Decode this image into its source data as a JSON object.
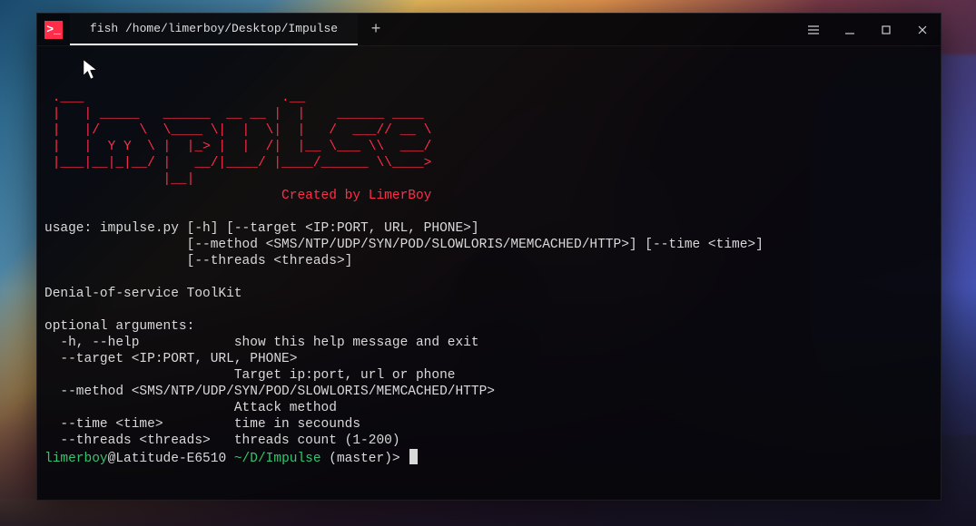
{
  "titlebar": {
    "app_badge_glyph": ">_",
    "tab_title": "fish /home/limerboy/Desktop/Impulse",
    "newtab_glyph": "+"
  },
  "terminal": {
    "ascii_art": " .___                         .__                  \n |   | _____   ______  __ __ |  |    ______ ____  \n |   |/     \\  \\____ \\|  |  \\|  |   /  ___// __ \\ \n |   |  Y Y  \\ |  |_> |  |  /|  |__ \\___ \\\\  ___/ \n |___|__|_|__/ |   __/|____/ |____/______ \\\\____>\n               |__|",
    "credit": "Created by LimerBoy",
    "usage_line1": "usage: impulse.py [-h] [--target <IP:PORT, URL, PHONE>]",
    "usage_line2": "                  [--method <SMS/NTP/UDP/SYN/POD/SLOWLORIS/MEMCACHED/HTTP>] [--time <time>]",
    "usage_line3": "                  [--threads <threads>]",
    "description": "Denial-of-service ToolKit",
    "opt_header": "optional arguments:",
    "opt_help": "  -h, --help            show this help message and exit",
    "opt_target1": "  --target <IP:PORT, URL, PHONE>",
    "opt_target2": "                        Target ip:port, url or phone",
    "opt_method1": "  --method <SMS/NTP/UDP/SYN/POD/SLOWLORIS/MEMCACHED/HTTP>",
    "opt_method2": "                        Attack method",
    "opt_time": "  --time <time>         time in secounds",
    "opt_threads": "  --threads <threads>   threads count (1-200)",
    "prompt": {
      "user": "limerboy",
      "at_host": "@Latitude-E6510 ",
      "path": "~/D/Impulse",
      "branch": " (master)> "
    }
  }
}
